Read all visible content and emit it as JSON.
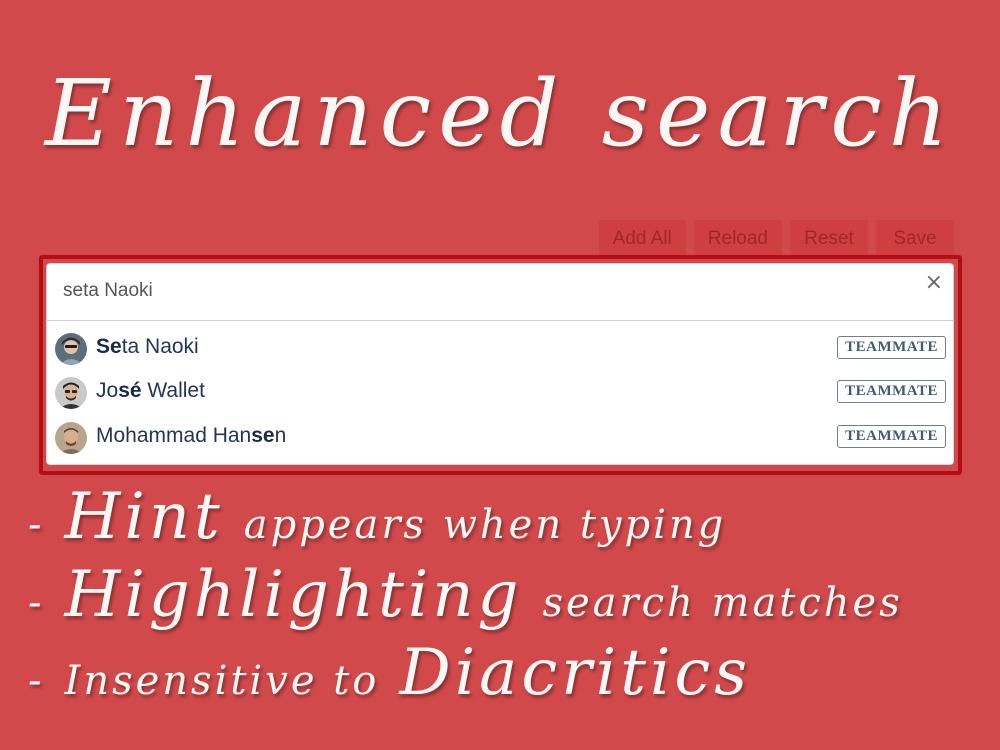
{
  "headline": "Enhanced search",
  "toolbar": {
    "add_all": "Add All",
    "reload": "Reload",
    "reset": "Reset",
    "save": "Save"
  },
  "search": {
    "value": "seta Naoki",
    "clear": "×"
  },
  "results": [
    {
      "pre": "",
      "bold": "Se",
      "post": "ta Naoki",
      "badge": "TEAMMATE"
    },
    {
      "pre": "Jo",
      "bold": "sé",
      "post": " Wallet",
      "badge": "TEAMMATE"
    },
    {
      "pre": "Mohammad Han",
      "bold": "se",
      "post": "n",
      "badge": "TEAMMATE"
    }
  ],
  "bullets": [
    {
      "dash": "-",
      "big": "Hint",
      "small": "appears when typing"
    },
    {
      "dash": "-",
      "big": "Highlighting",
      "small": "search matches"
    },
    {
      "dash": "-",
      "small": "Insensitive to",
      "big": "Diacritics"
    }
  ],
  "colors": {
    "background": "#d1494b",
    "frame": "#b50d12",
    "text_on_red": "#fbf7f5",
    "name": "#243658",
    "badge": "#415a79"
  }
}
